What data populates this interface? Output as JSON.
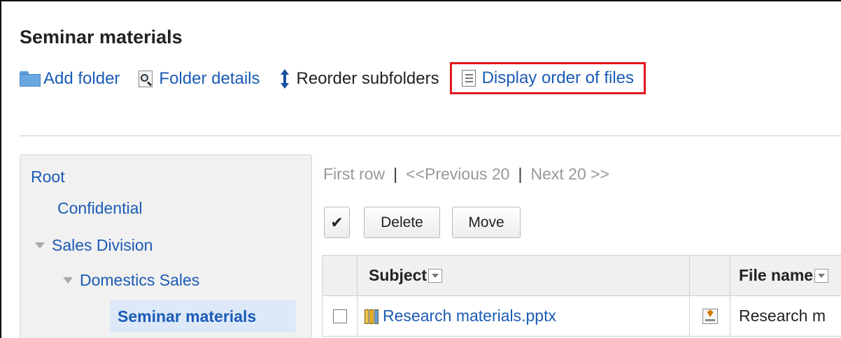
{
  "page": {
    "title": "Seminar materials"
  },
  "toolbar": {
    "add_folder": "Add folder",
    "folder_details": "Folder details",
    "reorder_subfolders": "Reorder subfolders",
    "display_order_of_files": "Display order of files"
  },
  "sidebar": {
    "root": "Root",
    "confidential": "Confidential",
    "sales_division": "Sales Division",
    "domestics_sales": "Domestics Sales",
    "selected": "Seminar materials"
  },
  "pager": {
    "first_row": "First row",
    "separator": "|",
    "previous": "<<Previous 20",
    "next": "Next 20 >>"
  },
  "actions": {
    "check_all": "✔",
    "delete": "Delete",
    "move": "Move"
  },
  "table": {
    "headers": {
      "subject": "Subject",
      "file_name": "File name"
    },
    "rows": [
      {
        "subject": "Research materials.pptx",
        "file_name": "Research m"
      }
    ]
  },
  "colors": {
    "link": "#1a5bb5",
    "highlight_border": "#e3151c",
    "selected_bg": "#dde9f9"
  }
}
